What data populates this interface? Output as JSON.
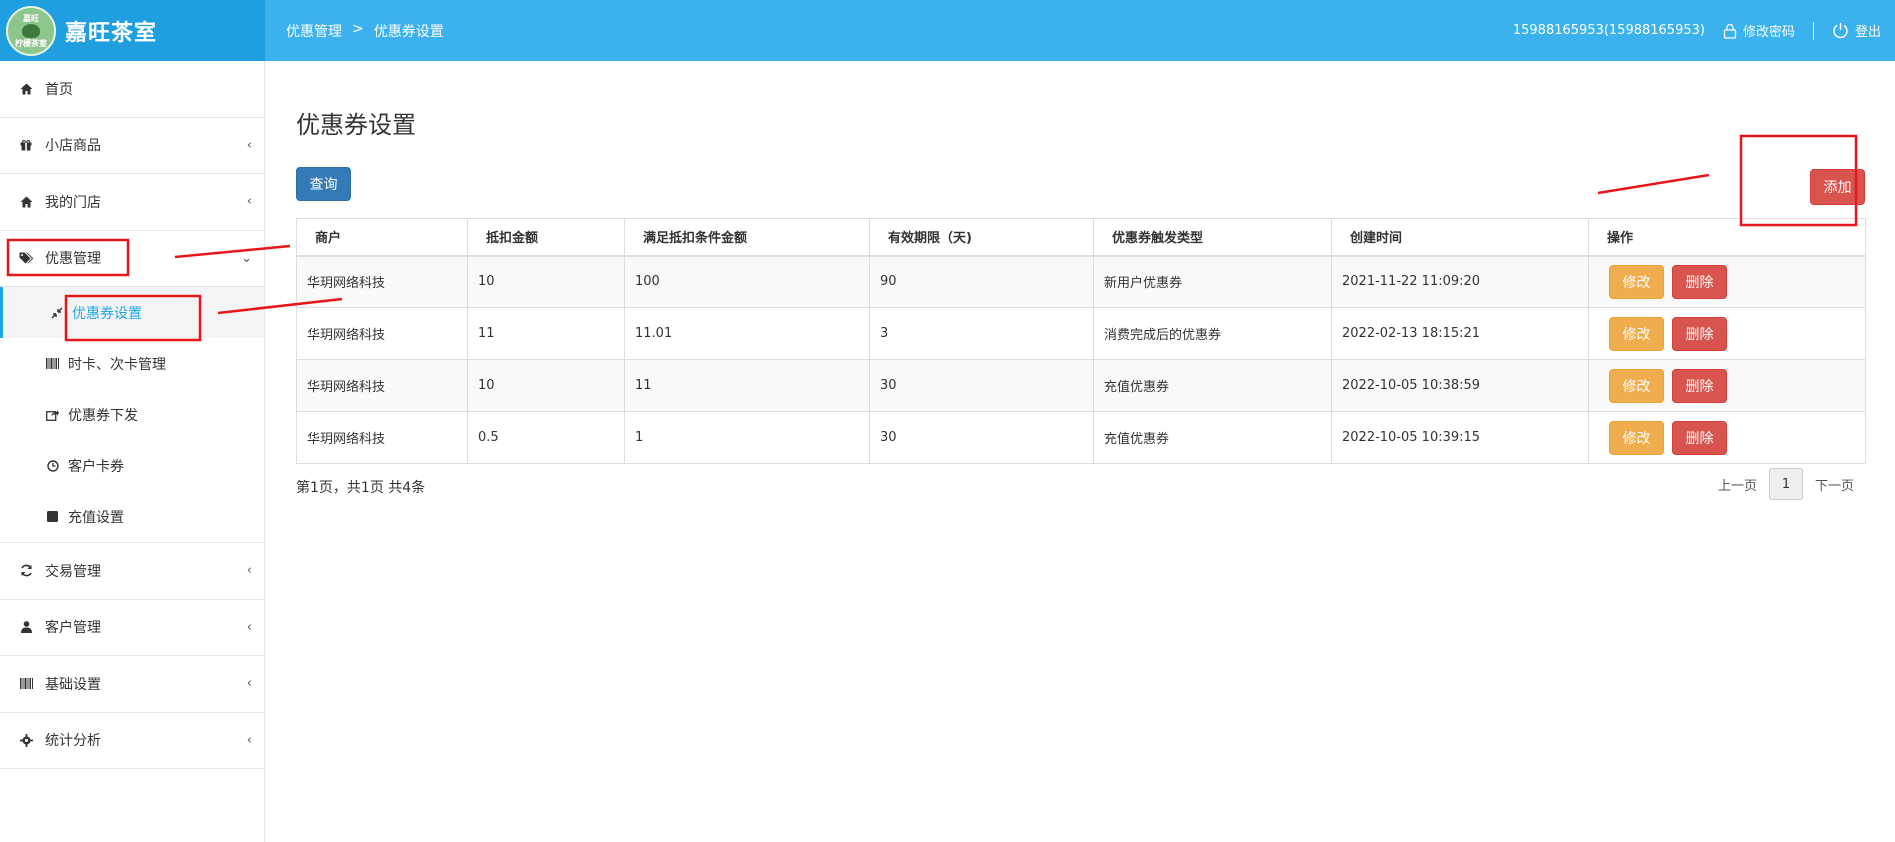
{
  "brand": {
    "name": "嘉旺茶室",
    "logo_top": "嘉旺",
    "logo_bottom": "柠檬茶室"
  },
  "header": {
    "breadcrumb": [
      "优惠管理",
      ">",
      "优惠券设置"
    ],
    "user": "15988165953(15988165953)",
    "change_password": "修改密码",
    "logout": "登出"
  },
  "sidebar": {
    "items": [
      {
        "label": "首页",
        "icon": "home-icon"
      },
      {
        "label": "小店商品",
        "icon": "gift-icon",
        "arrow": "‹"
      },
      {
        "label": "我的门店",
        "icon": "home-icon",
        "arrow": "‹"
      },
      {
        "label": "优惠管理",
        "icon": "tags-icon",
        "arrow": "⌄"
      },
      {
        "label": "交易管理",
        "icon": "refresh-icon",
        "arrow": "‹"
      },
      {
        "label": "客户管理",
        "icon": "user-icon",
        "arrow": "‹"
      },
      {
        "label": "基础设置",
        "icon": "barcode-icon",
        "arrow": "‹"
      },
      {
        "label": "统计分析",
        "icon": "gear-icon",
        "arrow": "‹"
      }
    ],
    "sub_items": [
      {
        "label": "优惠券设置",
        "icon": "compress-icon",
        "active": true
      },
      {
        "label": "时卡、次卡管理",
        "icon": "barcode-icon"
      },
      {
        "label": "优惠券下发",
        "icon": "share-icon"
      },
      {
        "label": "客户卡券",
        "icon": "clock-icon"
      },
      {
        "label": "充值设置",
        "icon": "stop-icon"
      }
    ]
  },
  "main": {
    "title": "优惠券设置",
    "query_label": "查询",
    "add_label": "添加",
    "table": {
      "headers": [
        "商户",
        "抵扣金额",
        "满足抵扣条件金额",
        "有效期限（天)",
        "优惠券触发类型",
        "创建时间",
        "操作"
      ],
      "rows": [
        [
          "华玥网络科技",
          "10",
          "100",
          "90",
          "新用户优惠券",
          "2021-11-22 11:09:20"
        ],
        [
          "华玥网络科技",
          "11",
          "11.01",
          "3",
          "消费完成后的优惠券",
          "2022-02-13 18:15:21"
        ],
        [
          "华玥网络科技",
          "10",
          "11",
          "30",
          "充值优惠券",
          "2022-10-05 10:38:59"
        ],
        [
          "华玥网络科技",
          "0.5",
          "1",
          "30",
          "充值优惠券",
          "2022-10-05 10:39:15"
        ]
      ],
      "edit_label": "修改",
      "delete_label": "删除"
    },
    "pagination": {
      "info": "第1页，共1页 共4条",
      "prev": "上一页",
      "current": "1",
      "next": "下一页"
    }
  },
  "colors": {
    "header_brand": "#1f9fe0",
    "header_bar": "#3bb2ee",
    "primary": "#337ab7",
    "danger": "#d9534f",
    "warning": "#f0ad4e",
    "active_link": "#1fa6e6",
    "annotation": "#e8161b"
  }
}
